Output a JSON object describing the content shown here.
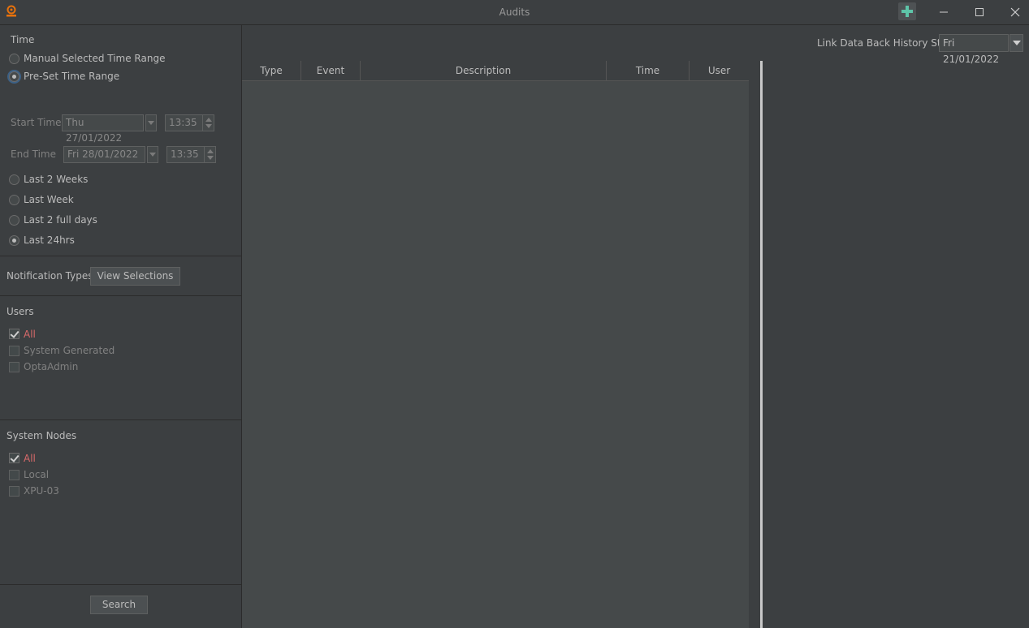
{
  "window": {
    "title": "Audits"
  },
  "icons": {
    "app": "app-logo-icon",
    "add": "plus-icon",
    "minimize": "minimize-icon",
    "maximize": "maximize-icon",
    "close": "close-icon"
  },
  "colors": {
    "accent_orange": "#e8720c",
    "add_green": "#5ec4a8",
    "selected_red": "#d96a6a",
    "background": "#3c3f41"
  },
  "time": {
    "heading": "Time",
    "manual_label": "Manual Selected Time Range",
    "preset_label": "Pre-Set Time Range",
    "start_label": "Start Time",
    "start_date": "Thu 27/01/2022",
    "start_time": "13:35",
    "end_label": "End Time",
    "end_date": "Fri 28/01/2022",
    "end_time": "13:35",
    "presets": [
      "Last 2 Weeks",
      "Last Week",
      "Last 2 full days",
      "Last 24hrs"
    ],
    "selected_preset": "Last 24hrs"
  },
  "notification": {
    "label": "Notification Types",
    "button": "View Selections"
  },
  "users": {
    "heading": "Users",
    "items": [
      "All",
      "System Generated",
      "OptaAdmin"
    ]
  },
  "nodes": {
    "heading": "System Nodes",
    "items": [
      "All",
      "Local",
      "XPU-03"
    ]
  },
  "search_button": "Search",
  "history": {
    "label": "Link Data Back History Start",
    "value": "Fri 21/01/2022"
  },
  "table": {
    "columns": [
      "Type",
      "Event",
      "Description",
      "Time",
      "User"
    ]
  }
}
